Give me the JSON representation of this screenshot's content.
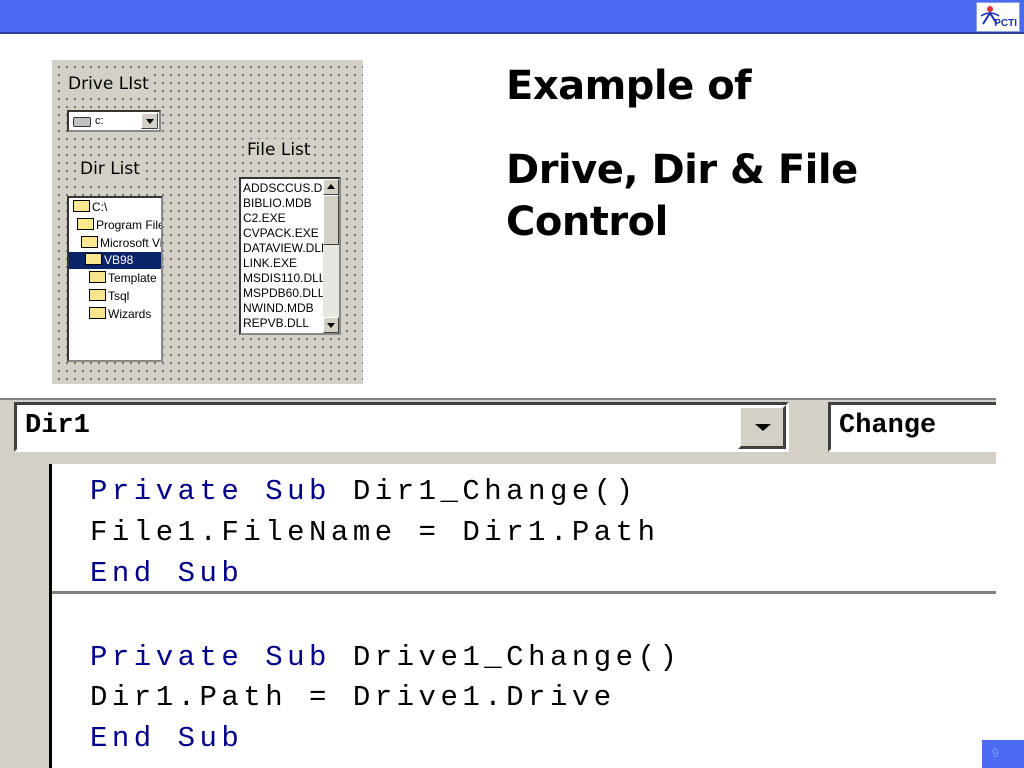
{
  "header": {
    "bar_color": "#4a6cf0",
    "logo_text": "PCTI"
  },
  "slide": {
    "title_line1": "Example of",
    "title_line2": "Drive, Dir & File",
    "title_line3": "Control"
  },
  "form": {
    "drive_label": "Drive LIst",
    "drive_value": "c:",
    "dir_label": "Dir List",
    "file_label": "File List",
    "dir_items": [
      {
        "label": "C:\\",
        "selected": false
      },
      {
        "label": "Program Files",
        "selected": false
      },
      {
        "label": "Microsoft Visual Studio",
        "selected": false
      },
      {
        "label": "VB98",
        "selected": true
      },
      {
        "label": "Template",
        "selected": false
      },
      {
        "label": "Tsql",
        "selected": false
      },
      {
        "label": "Wizards",
        "selected": false
      }
    ],
    "file_items": [
      "ADDSCCUS.DLL",
      "BIBLIO.MDB",
      "C2.EXE",
      "CVPACK.EXE",
      "DATAVIEW.DLL",
      "LINK.EXE",
      "MSDIS110.DLL",
      "MSPDB60.DLL",
      "NWIND.MDB",
      "REPVB.DLL"
    ]
  },
  "editor": {
    "object_value": "Dir1",
    "procedure_value": "Change",
    "keyword_color": "#00008b",
    "block1": {
      "line1_kw": "Private Sub",
      "line1_rest": " Dir1_Change()",
      "line2": "File1.FileName = Dir1.Path",
      "line3_kw": "End Sub"
    },
    "block2": {
      "line1_kw": "Private Sub",
      "line1_rest": " Drive1_Change()",
      "line2": "Dir1.Path = Drive1.Drive",
      "line3_kw": "End Sub"
    }
  },
  "footer": {
    "page_number": "9"
  }
}
